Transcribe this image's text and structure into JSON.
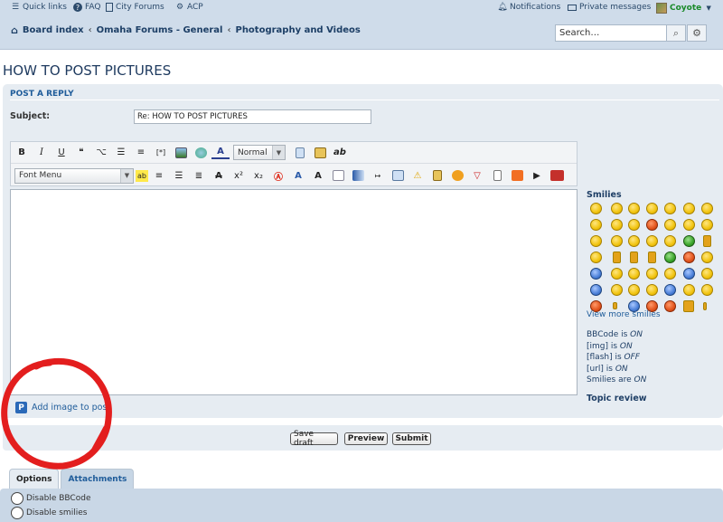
{
  "topbar": {
    "quick_links": "Quick links",
    "faq": "FAQ",
    "city_forums": "City Forums",
    "acp": "ACP",
    "notifications": "Notifications",
    "private_messages": "Private messages",
    "username": "Coyote"
  },
  "breadcrumb": {
    "items": [
      "Board index",
      "Omaha Forums - General",
      "Photography and Videos"
    ],
    "separator": "‹"
  },
  "search": {
    "placeholder": "Search…"
  },
  "page": {
    "title": "HOW TO POST PICTURES"
  },
  "post_form": {
    "heading": "POST A REPLY",
    "subject_label": "Subject:",
    "subject_value": "Re: HOW TO POST PICTURES"
  },
  "editor": {
    "bold": "B",
    "italic": "I",
    "underline": "U",
    "font_size": "Normal",
    "font_menu": "Font Menu",
    "ab_label": "ab"
  },
  "add_image": {
    "label": "Add image to post"
  },
  "sidebar": {
    "smilies_heading": "Smilies",
    "view_more": "View more smilies",
    "status": [
      {
        "pre": "BBCode is ",
        "state": "ON"
      },
      {
        "pre": "[img] is ",
        "state": "ON"
      },
      {
        "pre": "[flash] is ",
        "state": "OFF"
      },
      {
        "pre": "[url] is ",
        "state": "ON"
      },
      {
        "pre": "Smilies are ",
        "state": "ON"
      }
    ],
    "topic_review": "Topic review"
  },
  "buttons": {
    "save_draft": "Save draft",
    "preview": "Preview",
    "submit": "Submit"
  },
  "tabs": {
    "options": "Options",
    "attachments": "Attachments"
  },
  "options": {
    "disable_bbcode": "Disable BBCode",
    "disable_smilies": "Disable smilies"
  },
  "colors": {
    "header_bg": "#cfdcea",
    "panel_bg": "#e6ecf2",
    "link": "#1f5c9a",
    "title": "#1e3a5f",
    "annotation": "#e31e1e"
  }
}
